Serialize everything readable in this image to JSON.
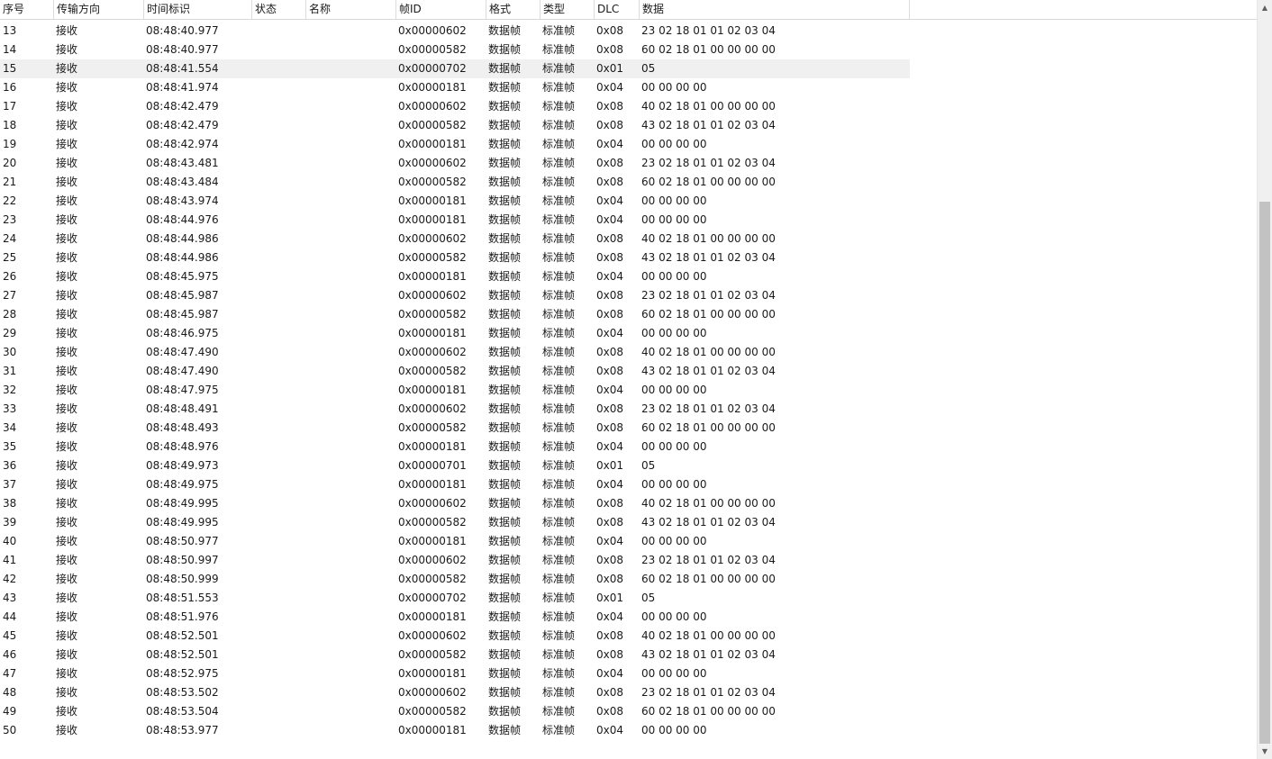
{
  "columns": {
    "seq": "序号",
    "dir": "传输方向",
    "time": "时间标识",
    "status": "状态",
    "name": "名称",
    "id": "帧ID",
    "fmt": "格式",
    "type": "类型",
    "dlc": "DLC",
    "data": "数据"
  },
  "scrollbar": {
    "up_icon": "chevron-up-icon",
    "down_icon": "chevron-down-icon",
    "up_glyph": "▲",
    "down_glyph": "▼",
    "position_fraction": 0.27
  },
  "selected_row_index": 2,
  "rows": [
    {
      "seq": "13",
      "dir": "接收",
      "time": "08:48:40.977",
      "status": "",
      "name": "",
      "id": "0x00000602",
      "fmt": "数据帧",
      "type": "标准帧",
      "dlc": "0x08",
      "data": "23 02 18 01 01 02 03 04"
    },
    {
      "seq": "14",
      "dir": "接收",
      "time": "08:48:40.977",
      "status": "",
      "name": "",
      "id": "0x00000582",
      "fmt": "数据帧",
      "type": "标准帧",
      "dlc": "0x08",
      "data": "60 02 18 01 00 00 00 00"
    },
    {
      "seq": "15",
      "dir": "接收",
      "time": "08:48:41.554",
      "status": "",
      "name": "",
      "id": "0x00000702",
      "fmt": "数据帧",
      "type": "标准帧",
      "dlc": "0x01",
      "data": "05"
    },
    {
      "seq": "16",
      "dir": "接收",
      "time": "08:48:41.974",
      "status": "",
      "name": "",
      "id": "0x00000181",
      "fmt": "数据帧",
      "type": "标准帧",
      "dlc": "0x04",
      "data": "00 00 00 00"
    },
    {
      "seq": "17",
      "dir": "接收",
      "time": "08:48:42.479",
      "status": "",
      "name": "",
      "id": "0x00000602",
      "fmt": "数据帧",
      "type": "标准帧",
      "dlc": "0x08",
      "data": "40 02 18 01 00 00 00 00"
    },
    {
      "seq": "18",
      "dir": "接收",
      "time": "08:48:42.479",
      "status": "",
      "name": "",
      "id": "0x00000582",
      "fmt": "数据帧",
      "type": "标准帧",
      "dlc": "0x08",
      "data": "43 02 18 01 01 02 03 04"
    },
    {
      "seq": "19",
      "dir": "接收",
      "time": "08:48:42.974",
      "status": "",
      "name": "",
      "id": "0x00000181",
      "fmt": "数据帧",
      "type": "标准帧",
      "dlc": "0x04",
      "data": "00 00 00 00"
    },
    {
      "seq": "20",
      "dir": "接收",
      "time": "08:48:43.481",
      "status": "",
      "name": "",
      "id": "0x00000602",
      "fmt": "数据帧",
      "type": "标准帧",
      "dlc": "0x08",
      "data": "23 02 18 01 01 02 03 04"
    },
    {
      "seq": "21",
      "dir": "接收",
      "time": "08:48:43.484",
      "status": "",
      "name": "",
      "id": "0x00000582",
      "fmt": "数据帧",
      "type": "标准帧",
      "dlc": "0x08",
      "data": "60 02 18 01 00 00 00 00"
    },
    {
      "seq": "22",
      "dir": "接收",
      "time": "08:48:43.974",
      "status": "",
      "name": "",
      "id": "0x00000181",
      "fmt": "数据帧",
      "type": "标准帧",
      "dlc": "0x04",
      "data": "00 00 00 00"
    },
    {
      "seq": "23",
      "dir": "接收",
      "time": "08:48:44.976",
      "status": "",
      "name": "",
      "id": "0x00000181",
      "fmt": "数据帧",
      "type": "标准帧",
      "dlc": "0x04",
      "data": "00 00 00 00"
    },
    {
      "seq": "24",
      "dir": "接收",
      "time": "08:48:44.986",
      "status": "",
      "name": "",
      "id": "0x00000602",
      "fmt": "数据帧",
      "type": "标准帧",
      "dlc": "0x08",
      "data": "40 02 18 01 00 00 00 00"
    },
    {
      "seq": "25",
      "dir": "接收",
      "time": "08:48:44.986",
      "status": "",
      "name": "",
      "id": "0x00000582",
      "fmt": "数据帧",
      "type": "标准帧",
      "dlc": "0x08",
      "data": "43 02 18 01 01 02 03 04"
    },
    {
      "seq": "26",
      "dir": "接收",
      "time": "08:48:45.975",
      "status": "",
      "name": "",
      "id": "0x00000181",
      "fmt": "数据帧",
      "type": "标准帧",
      "dlc": "0x04",
      "data": "00 00 00 00"
    },
    {
      "seq": "27",
      "dir": "接收",
      "time": "08:48:45.987",
      "status": "",
      "name": "",
      "id": "0x00000602",
      "fmt": "数据帧",
      "type": "标准帧",
      "dlc": "0x08",
      "data": "23 02 18 01 01 02 03 04"
    },
    {
      "seq": "28",
      "dir": "接收",
      "time": "08:48:45.987",
      "status": "",
      "name": "",
      "id": "0x00000582",
      "fmt": "数据帧",
      "type": "标准帧",
      "dlc": "0x08",
      "data": "60 02 18 01 00 00 00 00"
    },
    {
      "seq": "29",
      "dir": "接收",
      "time": "08:48:46.975",
      "status": "",
      "name": "",
      "id": "0x00000181",
      "fmt": "数据帧",
      "type": "标准帧",
      "dlc": "0x04",
      "data": "00 00 00 00"
    },
    {
      "seq": "30",
      "dir": "接收",
      "time": "08:48:47.490",
      "status": "",
      "name": "",
      "id": "0x00000602",
      "fmt": "数据帧",
      "type": "标准帧",
      "dlc": "0x08",
      "data": "40 02 18 01 00 00 00 00"
    },
    {
      "seq": "31",
      "dir": "接收",
      "time": "08:48:47.490",
      "status": "",
      "name": "",
      "id": "0x00000582",
      "fmt": "数据帧",
      "type": "标准帧",
      "dlc": "0x08",
      "data": "43 02 18 01 01 02 03 04"
    },
    {
      "seq": "32",
      "dir": "接收",
      "time": "08:48:47.975",
      "status": "",
      "name": "",
      "id": "0x00000181",
      "fmt": "数据帧",
      "type": "标准帧",
      "dlc": "0x04",
      "data": "00 00 00 00"
    },
    {
      "seq": "33",
      "dir": "接收",
      "time": "08:48:48.491",
      "status": "",
      "name": "",
      "id": "0x00000602",
      "fmt": "数据帧",
      "type": "标准帧",
      "dlc": "0x08",
      "data": "23 02 18 01 01 02 03 04"
    },
    {
      "seq": "34",
      "dir": "接收",
      "time": "08:48:48.493",
      "status": "",
      "name": "",
      "id": "0x00000582",
      "fmt": "数据帧",
      "type": "标准帧",
      "dlc": "0x08",
      "data": "60 02 18 01 00 00 00 00"
    },
    {
      "seq": "35",
      "dir": "接收",
      "time": "08:48:48.976",
      "status": "",
      "name": "",
      "id": "0x00000181",
      "fmt": "数据帧",
      "type": "标准帧",
      "dlc": "0x04",
      "data": "00 00 00 00"
    },
    {
      "seq": "36",
      "dir": "接收",
      "time": "08:48:49.973",
      "status": "",
      "name": "",
      "id": "0x00000701",
      "fmt": "数据帧",
      "type": "标准帧",
      "dlc": "0x01",
      "data": "05"
    },
    {
      "seq": "37",
      "dir": "接收",
      "time": "08:48:49.975",
      "status": "",
      "name": "",
      "id": "0x00000181",
      "fmt": "数据帧",
      "type": "标准帧",
      "dlc": "0x04",
      "data": "00 00 00 00"
    },
    {
      "seq": "38",
      "dir": "接收",
      "time": "08:48:49.995",
      "status": "",
      "name": "",
      "id": "0x00000602",
      "fmt": "数据帧",
      "type": "标准帧",
      "dlc": "0x08",
      "data": "40 02 18 01 00 00 00 00"
    },
    {
      "seq": "39",
      "dir": "接收",
      "time": "08:48:49.995",
      "status": "",
      "name": "",
      "id": "0x00000582",
      "fmt": "数据帧",
      "type": "标准帧",
      "dlc": "0x08",
      "data": "43 02 18 01 01 02 03 04"
    },
    {
      "seq": "40",
      "dir": "接收",
      "time": "08:48:50.977",
      "status": "",
      "name": "",
      "id": "0x00000181",
      "fmt": "数据帧",
      "type": "标准帧",
      "dlc": "0x04",
      "data": "00 00 00 00"
    },
    {
      "seq": "41",
      "dir": "接收",
      "time": "08:48:50.997",
      "status": "",
      "name": "",
      "id": "0x00000602",
      "fmt": "数据帧",
      "type": "标准帧",
      "dlc": "0x08",
      "data": "23 02 18 01 01 02 03 04"
    },
    {
      "seq": "42",
      "dir": "接收",
      "time": "08:48:50.999",
      "status": "",
      "name": "",
      "id": "0x00000582",
      "fmt": "数据帧",
      "type": "标准帧",
      "dlc": "0x08",
      "data": "60 02 18 01 00 00 00 00"
    },
    {
      "seq": "43",
      "dir": "接收",
      "time": "08:48:51.553",
      "status": "",
      "name": "",
      "id": "0x00000702",
      "fmt": "数据帧",
      "type": "标准帧",
      "dlc": "0x01",
      "data": "05"
    },
    {
      "seq": "44",
      "dir": "接收",
      "time": "08:48:51.976",
      "status": "",
      "name": "",
      "id": "0x00000181",
      "fmt": "数据帧",
      "type": "标准帧",
      "dlc": "0x04",
      "data": "00 00 00 00"
    },
    {
      "seq": "45",
      "dir": "接收",
      "time": "08:48:52.501",
      "status": "",
      "name": "",
      "id": "0x00000602",
      "fmt": "数据帧",
      "type": "标准帧",
      "dlc": "0x08",
      "data": "40 02 18 01 00 00 00 00"
    },
    {
      "seq": "46",
      "dir": "接收",
      "time": "08:48:52.501",
      "status": "",
      "name": "",
      "id": "0x00000582",
      "fmt": "数据帧",
      "type": "标准帧",
      "dlc": "0x08",
      "data": "43 02 18 01 01 02 03 04"
    },
    {
      "seq": "47",
      "dir": "接收",
      "time": "08:48:52.975",
      "status": "",
      "name": "",
      "id": "0x00000181",
      "fmt": "数据帧",
      "type": "标准帧",
      "dlc": "0x04",
      "data": "00 00 00 00"
    },
    {
      "seq": "48",
      "dir": "接收",
      "time": "08:48:53.502",
      "status": "",
      "name": "",
      "id": "0x00000602",
      "fmt": "数据帧",
      "type": "标准帧",
      "dlc": "0x08",
      "data": "23 02 18 01 01 02 03 04"
    },
    {
      "seq": "49",
      "dir": "接收",
      "time": "08:48:53.504",
      "status": "",
      "name": "",
      "id": "0x00000582",
      "fmt": "数据帧",
      "type": "标准帧",
      "dlc": "0x08",
      "data": "60 02 18 01 00 00 00 00"
    },
    {
      "seq": "50",
      "dir": "接收",
      "time": "08:48:53.977",
      "status": "",
      "name": "",
      "id": "0x00000181",
      "fmt": "数据帧",
      "type": "标准帧",
      "dlc": "0x04",
      "data": "00 00 00 00"
    }
  ]
}
